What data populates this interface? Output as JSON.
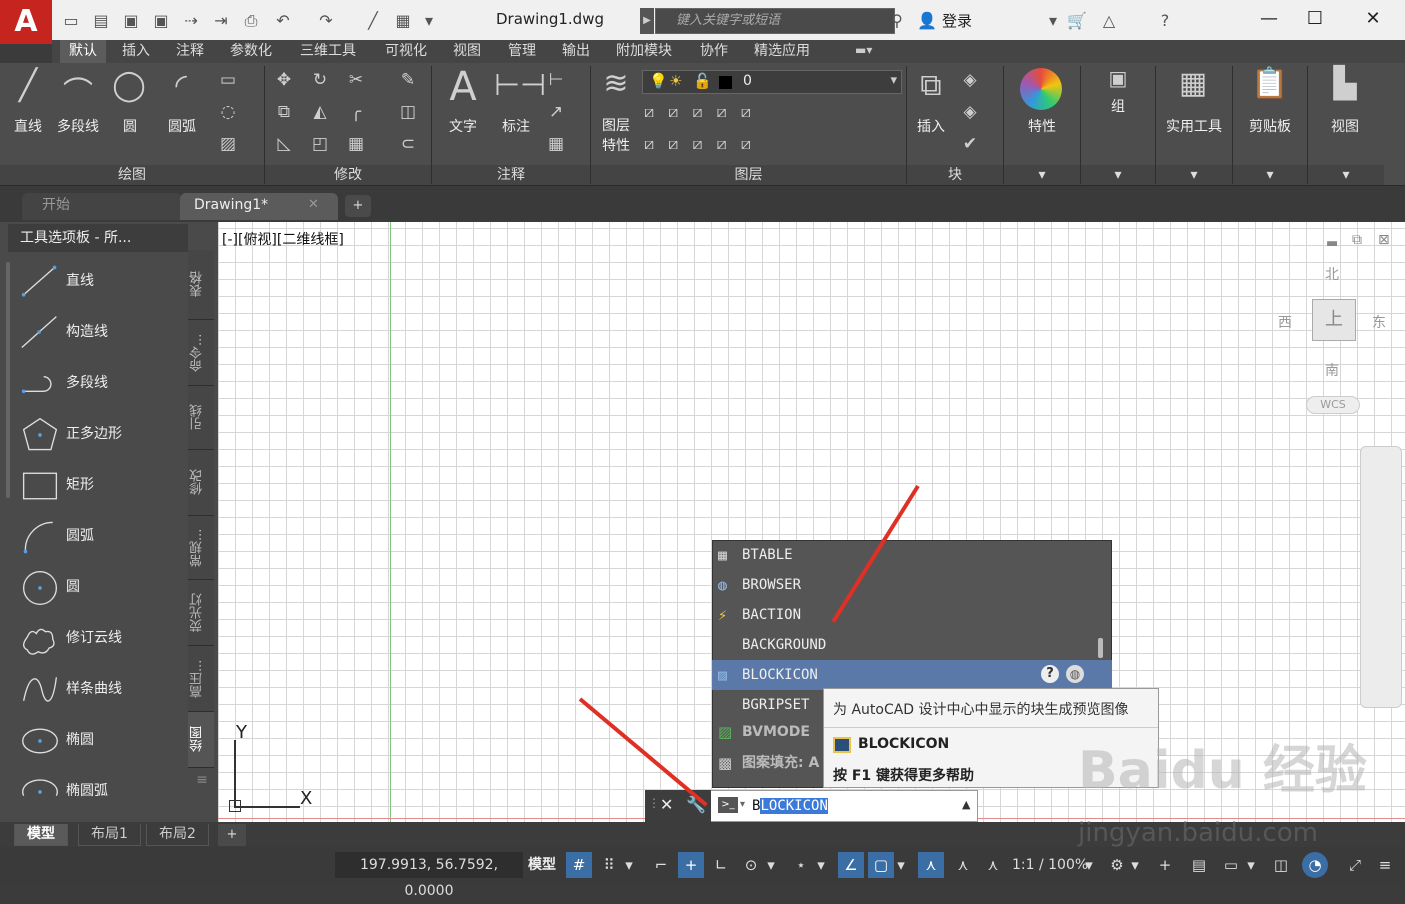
{
  "app": {
    "logo": "A",
    "document_title": "Drawing1.dwg",
    "search_placeholder": "键入关键字或短语",
    "login": "登录"
  },
  "ribbon_tabs": [
    "默认",
    "插入",
    "注释",
    "参数化",
    "三维工具",
    "可视化",
    "视图",
    "管理",
    "输出",
    "附加模块",
    "协作",
    "精选应用"
  ],
  "ribbon": {
    "draw": {
      "title": "绘图",
      "line": "直线",
      "polyline": "多段线",
      "circle": "圆",
      "arc": "圆弧"
    },
    "modify": {
      "title": "修改"
    },
    "annotation": {
      "title": "注释",
      "text": "文字",
      "dimension": "标注"
    },
    "layers": {
      "title": "图层",
      "props_line1": "图层",
      "props_line2": "特性",
      "current_layer": "0"
    },
    "block": {
      "title": "块",
      "insert": "插入"
    },
    "properties": "特性",
    "groups": "组",
    "utilities": "实用工具",
    "clipboard": "剪贴板",
    "view": "视图"
  },
  "file_tabs": {
    "start": "开始",
    "drawing": "Drawing1*"
  },
  "palette": {
    "title": "工具选项板 - 所...",
    "tools": [
      "直线",
      "构造线",
      "多段线",
      "正多边形",
      "矩形",
      "圆弧",
      "圆",
      "修订云线",
      "样条曲线",
      "椭圆",
      "椭圆弧"
    ],
    "side_tabs": [
      "表格",
      "命令...",
      "引线",
      "修改",
      "常规...",
      "荧光灯",
      "高压...",
      "绘图"
    ]
  },
  "canvas": {
    "view_label": "[-][俯视][二维线框]"
  },
  "viewcube": {
    "north": "北",
    "south": "南",
    "east": "东",
    "west": "西",
    "top": "上",
    "wcs": "WCS"
  },
  "ucs": {
    "x": "X",
    "y": "Y"
  },
  "autocomplete": {
    "items": [
      "BTABLE",
      "BROWSER",
      "BACTION",
      "BACKGROUND",
      "BLOCKICON",
      "BGRIPSET",
      "BVMODE",
      "图案填充: A"
    ],
    "selected_index": 4,
    "tooltip_desc": "为 AutoCAD 设计中心中显示的块生成预览图像",
    "tooltip_cmd": "BLOCKICON",
    "tooltip_help": "按 F1 键获得更多帮助"
  },
  "command_line": {
    "typed": "B",
    "highlight": "LOCKICON"
  },
  "layout_tabs": [
    "模型",
    "布局1",
    "布局2"
  ],
  "status": {
    "coords": "197.9913, 56.7592, 0.0000",
    "model": "模型",
    "scale": "1:1 / 100%"
  },
  "watermark": "jingyan.baidu.com"
}
